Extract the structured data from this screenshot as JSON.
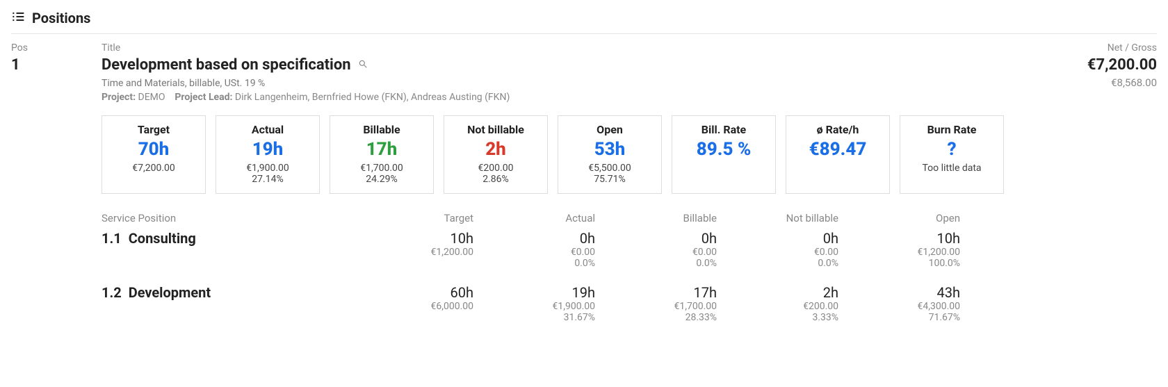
{
  "section_title": "Positions",
  "labels": {
    "pos": "Pos",
    "title": "Title",
    "net_gross": "Net / Gross",
    "project": "Project:",
    "project_lead": "Project Lead:",
    "service_position": "Service Position",
    "target": "Target",
    "actual": "Actual",
    "billable": "Billable",
    "not_billable": "Not billable",
    "open": "Open"
  },
  "position": {
    "number": "1",
    "title": "Development based on specification",
    "sub": "Time and Materials, billable, USt. 19 %",
    "project": "DEMO",
    "lead": "Dirk Langenheim, Bernfried Howe (FKN), Andreas Austing (FKN)",
    "net": "€7,200.00",
    "gross": "€8,568.00"
  },
  "cards": [
    {
      "label": "Target",
      "value": "70h",
      "color": "blue",
      "amount": "€7,200.00",
      "pct": ""
    },
    {
      "label": "Actual",
      "value": "19h",
      "color": "blue",
      "amount": "€1,900.00",
      "pct": "27.14%"
    },
    {
      "label": "Billable",
      "value": "17h",
      "color": "green",
      "amount": "€1,700.00",
      "pct": "24.29%"
    },
    {
      "label": "Not billable",
      "value": "2h",
      "color": "red",
      "amount": "€200.00",
      "pct": "2.86%"
    },
    {
      "label": "Open",
      "value": "53h",
      "color": "blue",
      "amount": "€5,500.00",
      "pct": "75.71%"
    },
    {
      "label": "Bill. Rate",
      "value": "89.5 %",
      "color": "blue",
      "amount": "",
      "pct": ""
    },
    {
      "label": "ø Rate/h",
      "value": "€89.47",
      "color": "blue",
      "amount": "",
      "pct": ""
    },
    {
      "label": "Burn Rate",
      "value": "?",
      "color": "blue",
      "amount": "Too little data",
      "pct": ""
    }
  ],
  "services": [
    {
      "num": "1.1",
      "name": "Consulting",
      "target": {
        "h": "10h",
        "amt": "€1,200.00",
        "pct": ""
      },
      "actual": {
        "h": "0h",
        "amt": "€0.00",
        "pct": "0.0%"
      },
      "billable": {
        "h": "0h",
        "amt": "€0.00",
        "pct": "0.0%"
      },
      "notbill": {
        "h": "0h",
        "amt": "€0.00",
        "pct": "0.0%"
      },
      "open": {
        "h": "10h",
        "amt": "€1,200.00",
        "pct": "100.0%"
      }
    },
    {
      "num": "1.2",
      "name": "Development",
      "target": {
        "h": "60h",
        "amt": "€6,000.00",
        "pct": ""
      },
      "actual": {
        "h": "19h",
        "amt": "€1,900.00",
        "pct": "31.67%"
      },
      "billable": {
        "h": "17h",
        "amt": "€1,700.00",
        "pct": "28.33%"
      },
      "notbill": {
        "h": "2h",
        "amt": "€200.00",
        "pct": "3.33%"
      },
      "open": {
        "h": "43h",
        "amt": "€4,300.00",
        "pct": "71.67%"
      }
    }
  ]
}
